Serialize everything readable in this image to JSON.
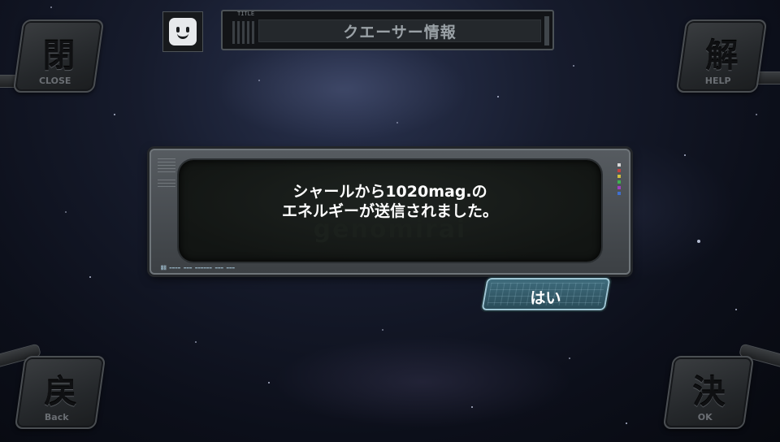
{
  "header": {
    "tag": "TITLE",
    "title": "クエーサー情報",
    "avatar_icon": "smiley-face-icon"
  },
  "corner_buttons": {
    "close": {
      "kanji": "閉",
      "label": "CLOSE"
    },
    "help": {
      "kanji": "解",
      "label": "HELP"
    },
    "back": {
      "kanji": "戻",
      "label": "Back"
    },
    "ok": {
      "kanji": "決",
      "label": "OK"
    }
  },
  "dialog": {
    "message_line1": "シャールから1020mag.の",
    "message_line2": "エネルギーが送信されました。",
    "watermark": "genomirai",
    "confirm_label": "はい"
  },
  "colors": {
    "confirm_button": "#3f6c7d",
    "confirm_border": "#9fc6d4",
    "panel_frame": "#565b60"
  }
}
